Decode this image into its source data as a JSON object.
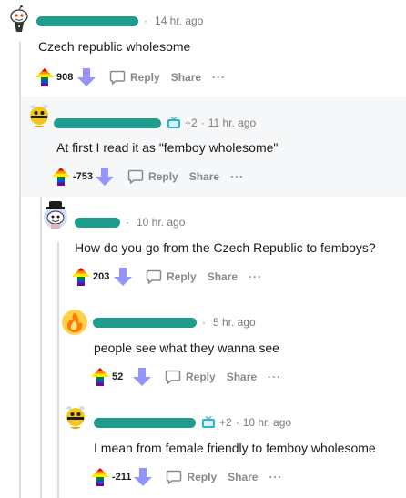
{
  "comments": [
    {
      "username": "",
      "flair_points": "",
      "time": "14 hr. ago",
      "body": "Czech republic wholesome",
      "score": "908",
      "reply_label": "Reply",
      "share_label": "Share",
      "more_label": "···"
    },
    {
      "username": "",
      "flair_points": "+2",
      "time": "11 hr. ago",
      "body": "At first I read it as \"femboy wholesome\"",
      "score": "-753",
      "reply_label": "Reply",
      "share_label": "Share",
      "more_label": "···"
    },
    {
      "username": "",
      "flair_points": "",
      "time": "10 hr. ago",
      "body": "How do you go from the Czech Republic to femboys?",
      "score": "203",
      "reply_label": "Reply",
      "share_label": "Share",
      "more_label": "···"
    },
    {
      "username": "",
      "flair_points": "",
      "time": "5 hr. ago",
      "body": "people see what they wanna see",
      "score": "52",
      "reply_label": "Reply",
      "share_label": "Share",
      "more_label": "···"
    },
    {
      "username": "",
      "flair_points": "+2",
      "time": "10 hr. ago",
      "body": "I mean from female friendly to femboy wholesome",
      "score": "-211",
      "reply_label": "Reply",
      "share_label": "Share",
      "more_label": "···"
    }
  ],
  "separator": "·",
  "colors": {
    "redaction": "#1f9c8c",
    "downvote": "#9494ff",
    "highlight_bg": "#f6f7f8",
    "thread_line": "#dcdde0"
  },
  "icons": {
    "upvote": "rainbow-up-arrow-icon",
    "downvote": "down-arrow-icon",
    "reply": "speech-bubble-icon",
    "flair": "tv-emoji-icon"
  }
}
